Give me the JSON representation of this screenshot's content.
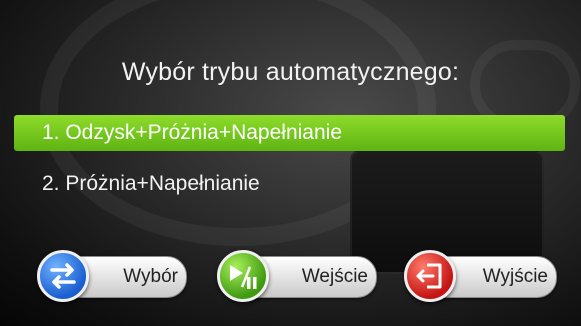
{
  "title": "Wybór trybu automatycznego:",
  "menu": {
    "items": [
      {
        "label": "1. Odzysk+Próżnia+Napełnianie",
        "selected": true
      },
      {
        "label": "2. Próżnia+Napełnianie",
        "selected": false
      }
    ]
  },
  "buttons": {
    "select": {
      "label": "Wybór",
      "icon": "swap-arrows-icon",
      "color": "#1a5fd0"
    },
    "enter": {
      "label": "Wejście",
      "icon": "play-pause-icon",
      "color": "#3f9a10"
    },
    "exit": {
      "label": "Wyjście",
      "icon": "exit-door-icon",
      "color": "#c41414"
    }
  },
  "colors": {
    "highlight": "#6cc41c"
  }
}
